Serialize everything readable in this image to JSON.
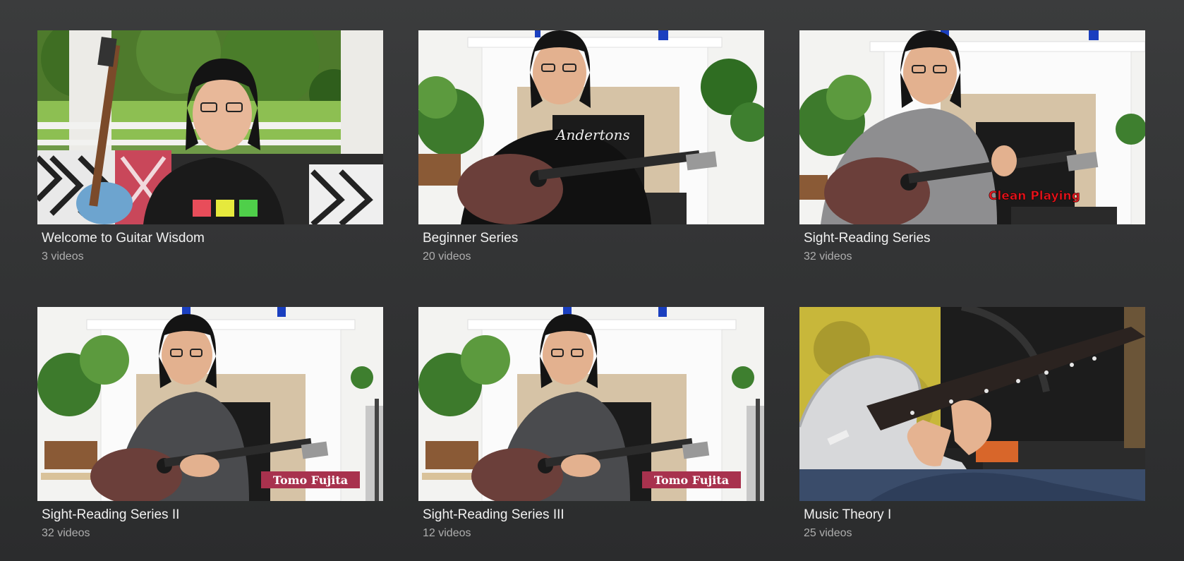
{
  "playlists": [
    {
      "title": "Welcome to Guitar Wisdom",
      "count": "3 videos",
      "overlay": "",
      "shirt_text": ""
    },
    {
      "title": "Beginner Series",
      "count": "20 videos",
      "overlay": "",
      "shirt_text": "Andertons"
    },
    {
      "title": "Sight-Reading Series",
      "count": "32 videos",
      "overlay": "Clean Playing",
      "shirt_text": ""
    },
    {
      "title": "Sight-Reading Series II",
      "count": "32 videos",
      "overlay": "Tomo Fujita",
      "shirt_text": ""
    },
    {
      "title": "Sight-Reading Series III",
      "count": "12 videos",
      "overlay": "Tomo Fujita",
      "shirt_text": ""
    },
    {
      "title": "Music Theory I",
      "count": "25 videos",
      "overlay": "",
      "shirt_text": ""
    }
  ],
  "colors": {
    "background": "#333435",
    "title_text": "#f1f1f1",
    "count_text": "#aeaeae",
    "overlay_red": "#e8141c",
    "name_banner": "#a8324e"
  }
}
